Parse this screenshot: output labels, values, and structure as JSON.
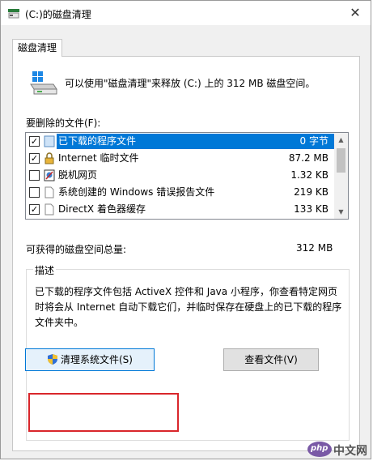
{
  "window": {
    "title": "(C:)的磁盘清理",
    "close_glyph": "✕"
  },
  "tab": {
    "label": "磁盘清理"
  },
  "intro": {
    "text": "可以使用\"磁盘清理\"来释放 (C:) 上的 312 MB 磁盘空间。"
  },
  "files": {
    "label": "要删除的文件(F):",
    "items": [
      {
        "name": "已下载的程序文件",
        "size": "0 字节",
        "checked": true,
        "selected": true,
        "icon": "folder-icon"
      },
      {
        "name": "Internet 临时文件",
        "size": "87.2 MB",
        "checked": true,
        "selected": false,
        "icon": "lock-icon"
      },
      {
        "name": "脱机网页",
        "size": "1.32 KB",
        "checked": false,
        "selected": false,
        "icon": "offline-pages-icon"
      },
      {
        "name": "系统创建的 Windows 错误报告文件",
        "size": "219 KB",
        "checked": false,
        "selected": false,
        "icon": "document-icon"
      },
      {
        "name": "DirectX 着色器缓存",
        "size": "133 KB",
        "checked": true,
        "selected": false,
        "icon": "document-icon"
      }
    ]
  },
  "total": {
    "label": "可获得的磁盘空间总量:",
    "value": "312 MB"
  },
  "description": {
    "title": "描述",
    "text": "已下载的程序文件包括 ActiveX 控件和 Java 小程序，你查看特定网页时将会从 Internet 自动下载它们，并临时保存在硬盘上的已下载的程序文件夹中。"
  },
  "buttons": {
    "clean_system": "清理系统文件(S)",
    "view_files": "查看文件(V)"
  },
  "watermark": {
    "brand": "php",
    "site": "中文网"
  },
  "colors": {
    "selection": "#0078d7",
    "highlight_box": "#d9262b"
  }
}
